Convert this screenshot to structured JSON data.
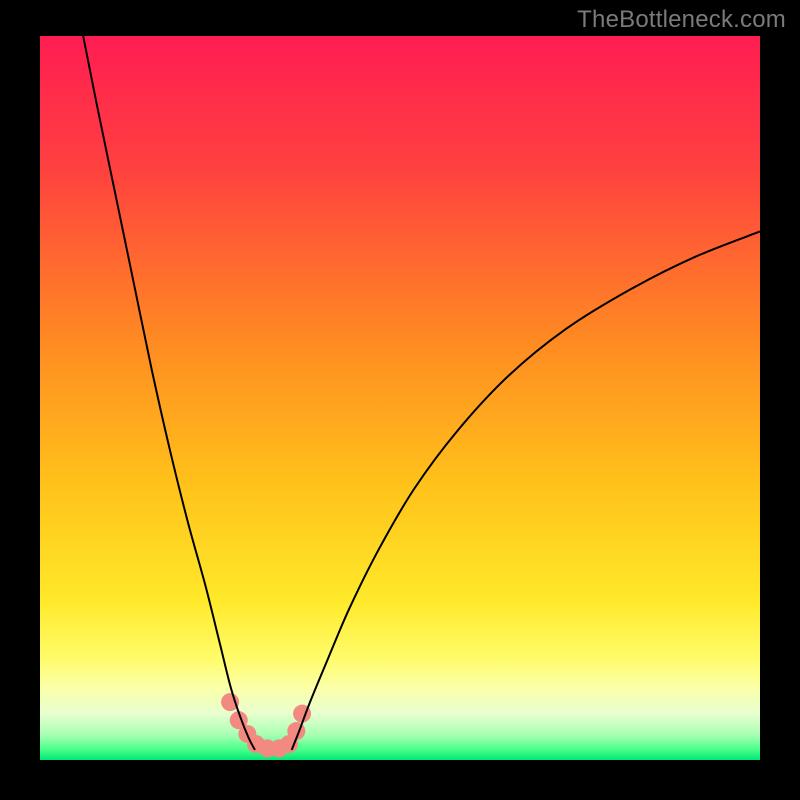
{
  "watermark": "TheBottleneck.com",
  "chart_data": {
    "type": "line",
    "title": "",
    "xlabel": "",
    "ylabel": "",
    "xlim": [
      0,
      100
    ],
    "ylim": [
      0,
      100
    ],
    "grid": false,
    "legend": false,
    "background_gradient_stops": [
      {
        "offset": 0.0,
        "color": "#ff1d52"
      },
      {
        "offset": 0.18,
        "color": "#ff4040"
      },
      {
        "offset": 0.42,
        "color": "#ff8a22"
      },
      {
        "offset": 0.62,
        "color": "#ffc21a"
      },
      {
        "offset": 0.78,
        "color": "#ffe92a"
      },
      {
        "offset": 0.86,
        "color": "#fffc6a"
      },
      {
        "offset": 0.9,
        "color": "#fbffa8"
      },
      {
        "offset": 0.935,
        "color": "#e9ffcf"
      },
      {
        "offset": 0.965,
        "color": "#a8ffb4"
      },
      {
        "offset": 0.985,
        "color": "#4cff8a"
      },
      {
        "offset": 1.0,
        "color": "#00e876"
      }
    ],
    "series": [
      {
        "name": "left-branch",
        "color": "#000000",
        "width": 2,
        "x": [
          6.0,
          8.0,
          10.5,
          13.0,
          15.5,
          18.0,
          20.5,
          23.0,
          25.0,
          26.5,
          27.8,
          29.0,
          29.8
        ],
        "y": [
          100.0,
          90.0,
          78.0,
          66.0,
          54.0,
          43.0,
          33.0,
          24.0,
          16.0,
          10.0,
          6.0,
          3.0,
          1.5
        ]
      },
      {
        "name": "right-branch",
        "color": "#000000",
        "width": 2,
        "x": [
          35.0,
          36.0,
          37.5,
          40.0,
          43.0,
          47.0,
          52.0,
          58.0,
          65.0,
          73.0,
          82.0,
          91.0,
          100.0
        ],
        "y": [
          1.5,
          4.0,
          8.0,
          14.0,
          21.0,
          29.0,
          37.5,
          45.5,
          53.0,
          59.5,
          65.0,
          69.5,
          73.0
        ]
      }
    ],
    "markers": {
      "name": "highlight-points",
      "color": "#f28a82",
      "radius_px": 9,
      "x": [
        26.4,
        27.6,
        28.8,
        30.0,
        31.6,
        33.2,
        34.6,
        35.6,
        36.4
      ],
      "y": [
        8.0,
        5.5,
        3.6,
        2.2,
        1.6,
        1.6,
        2.2,
        4.0,
        6.4
      ]
    }
  }
}
